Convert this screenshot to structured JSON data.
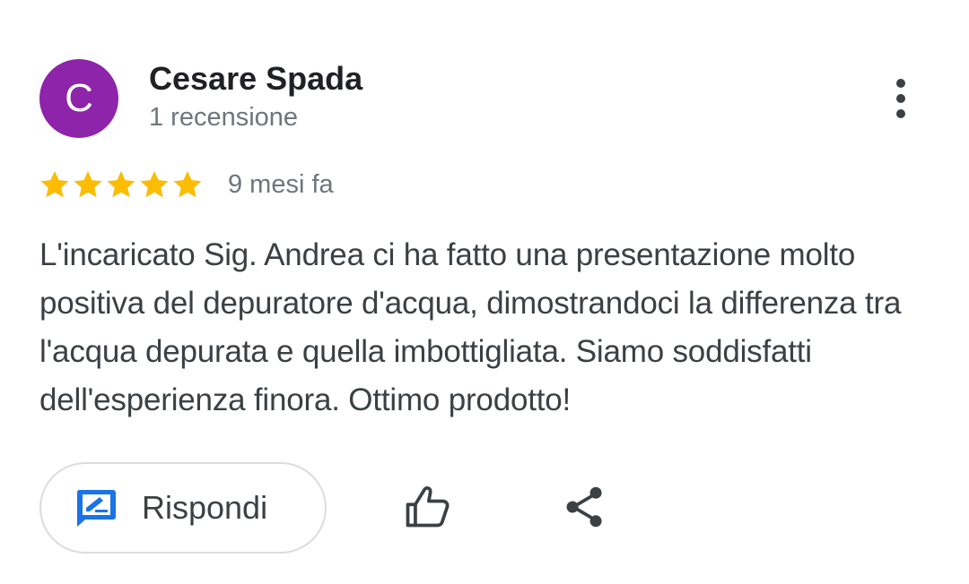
{
  "author": {
    "initial": "C",
    "name": "Cesare Spada",
    "review_count": "1 recensione",
    "avatar_color": "#8e24aa"
  },
  "rating": {
    "stars": 5,
    "max_stars": 5,
    "star_color": "#fbbc04",
    "date": "9 mesi fa"
  },
  "review": {
    "text": "L'incaricato Sig. Andrea ci ha fatto una presentazione molto positiva del depuratore d'acqua, dimostrandoci la differenza tra l'acqua depurata e quella imbottigliata. Siamo soddisfatti dell'esperienza finora. Ottimo prodotto!"
  },
  "actions": {
    "reply_label": "Rispondi",
    "reply_icon": "reply-edit-icon",
    "like_icon": "thumb-up-icon",
    "share_icon": "share-icon",
    "more_icon": "more-vert-icon",
    "accent_color": "#1a73e8"
  }
}
